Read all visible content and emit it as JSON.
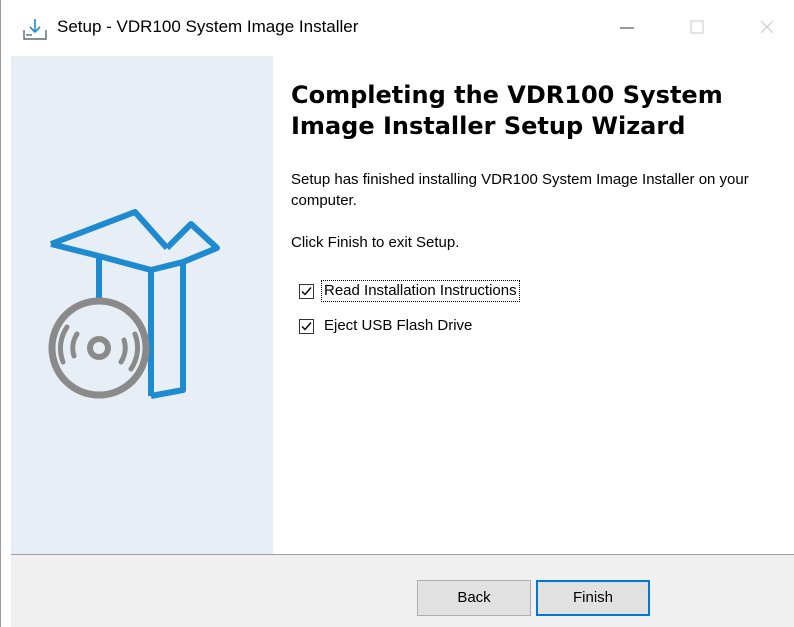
{
  "window": {
    "title": "Setup - VDR100 System Image Installer",
    "icon": "setup-installer-icon"
  },
  "content": {
    "heading": "Completing the VDR100 System Image Installer Setup Wizard",
    "message": "Setup has finished installing VDR100 System Image Installer on your computer.",
    "instruction": "Click Finish to exit Setup."
  },
  "options": [
    {
      "label": "Read Installation Instructions",
      "checked": true,
      "focused": true
    },
    {
      "label": "Eject USB Flash Drive",
      "checked": true,
      "focused": false
    }
  ],
  "buttons": {
    "back": "Back",
    "finish": "Finish"
  },
  "colors": {
    "panel": "#e8eef5",
    "accent": "#1e8bd0",
    "disc": "#8a8a8a",
    "default_button_border": "#0078d7"
  }
}
